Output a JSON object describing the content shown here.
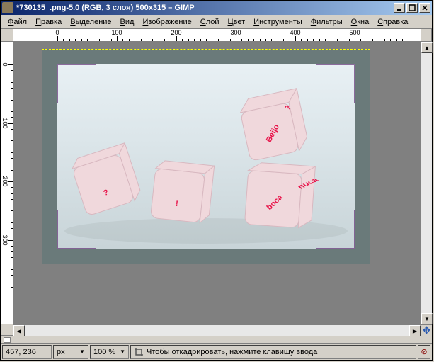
{
  "titlebar": {
    "text": "*730135_.png-5.0 (RGB, 3 слоя) 500x315 – GIMP"
  },
  "menu": {
    "items": [
      {
        "label": "Файл",
        "u": 0
      },
      {
        "label": "Правка",
        "u": 0
      },
      {
        "label": "Выделение",
        "u": 0
      },
      {
        "label": "Вид",
        "u": 0
      },
      {
        "label": "Изображение",
        "u": 0
      },
      {
        "label": "Слой",
        "u": 0
      },
      {
        "label": "Цвет",
        "u": 0
      },
      {
        "label": "Инструменты",
        "u": 0
      },
      {
        "label": "Фильтры",
        "u": 0
      },
      {
        "label": "Окна",
        "u": 0
      },
      {
        "label": "Справка",
        "u": 0
      }
    ]
  },
  "ruler": {
    "h_labels": [
      "0",
      "100",
      "200",
      "300",
      "400",
      "500"
    ],
    "v_labels": [
      "0",
      "100",
      "200",
      "300"
    ]
  },
  "dice_texts": [
    "?",
    "!",
    "Beijo",
    "?",
    "boca",
    "nuca"
  ],
  "status": {
    "coords": "457, 236",
    "unit": "px",
    "zoom": "100 %",
    "message": "Чтобы откадрировать, нажмите клавишу ввода"
  }
}
